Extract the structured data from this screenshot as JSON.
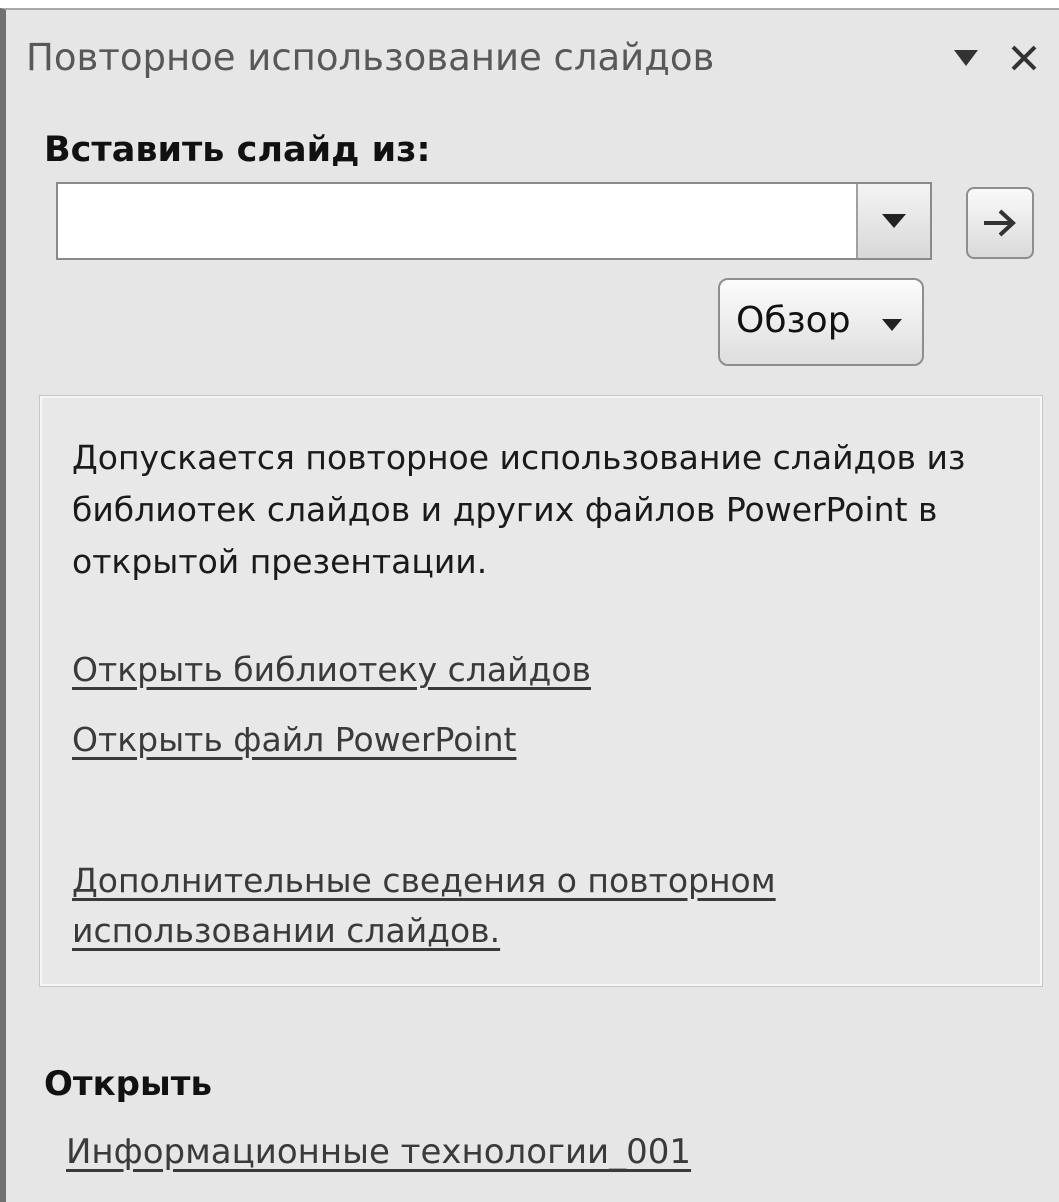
{
  "pane": {
    "title": "Повторное использование слайдов",
    "menu_icon": "triangle-down-icon",
    "close_icon": "close-icon"
  },
  "insert": {
    "label": "Вставить слайд из:",
    "source_value": "",
    "dropdown_icon": "chevron-down-icon",
    "go_icon": "arrow-right-icon",
    "browse_label": "Обзор"
  },
  "info": {
    "description": "Допускается повторное использование слайдов из библиотек слайдов и других файлов PowerPoint в открытой презентации.",
    "open_library_link": "Открыть библиотеку слайдов",
    "open_file_link": "Открыть файл PowerPoint",
    "more_info_link": "Дополнительные сведения о повторном использовании слайдов."
  },
  "recent": {
    "heading": "Открыть",
    "items": [
      "Информационные технологии_001"
    ]
  }
}
